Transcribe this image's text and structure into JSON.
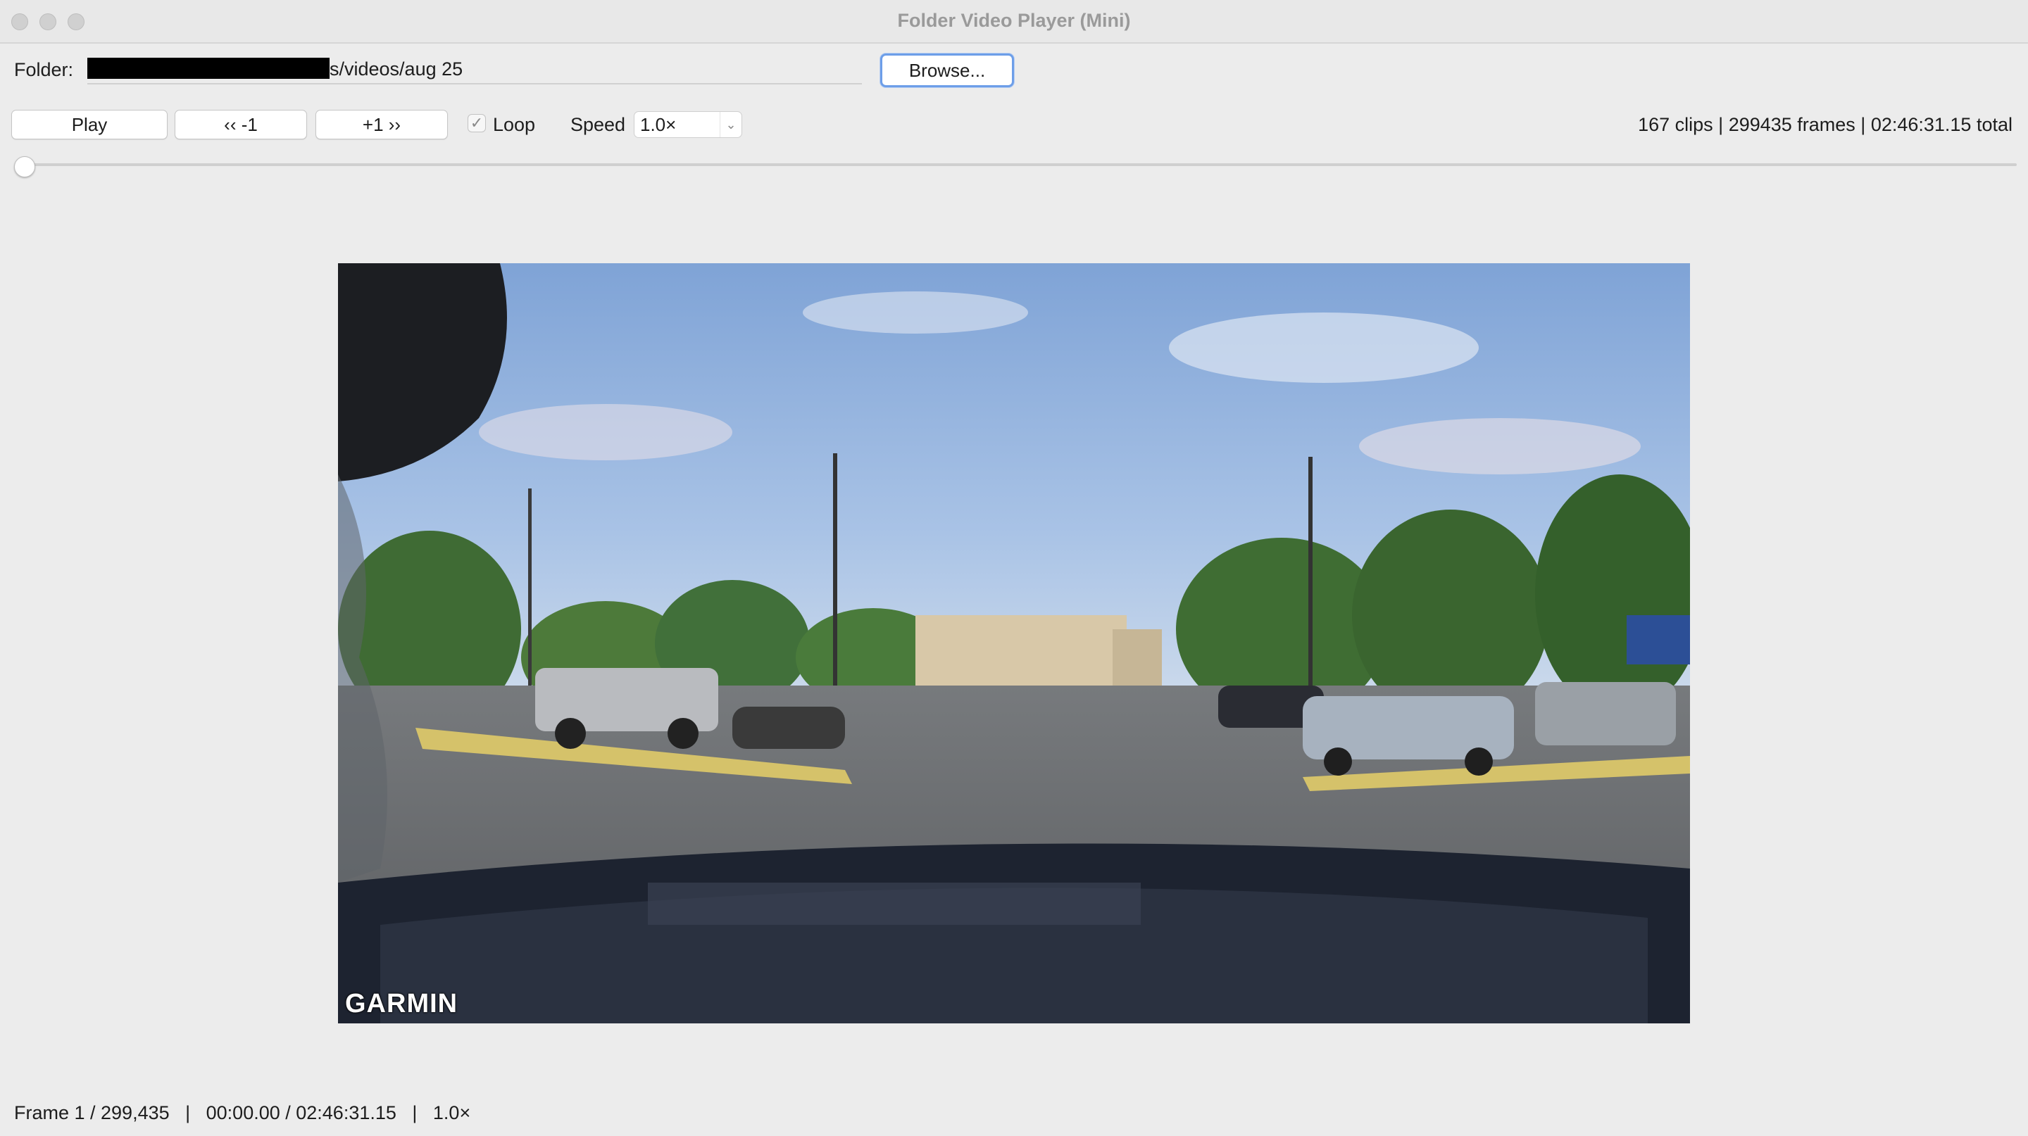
{
  "window": {
    "title": "Folder Video Player (Mini)"
  },
  "folder": {
    "label": "Folder:",
    "path_visible": "s/videos/aug 25",
    "browse_label": "Browse..."
  },
  "controls": {
    "play_label": "Play",
    "prev_label": "‹‹ -1",
    "next_label": "+1 ››",
    "loop_label": "Loop",
    "loop_checked": true,
    "speed_label": "Speed",
    "speed_value": "1.0×",
    "summary": "167 clips | 299435 frames | 02:46:31.15 total"
  },
  "scrubber": {
    "position_fraction": 0
  },
  "video": {
    "watermark": "GARMIN"
  },
  "status": {
    "text": "Frame 1 / 299,435   |   00:00.00 / 02:46:31.15   |   1.0×"
  },
  "icons": {
    "checkbox": "checkmark-icon",
    "dropdown": "chevron-down-icon"
  }
}
